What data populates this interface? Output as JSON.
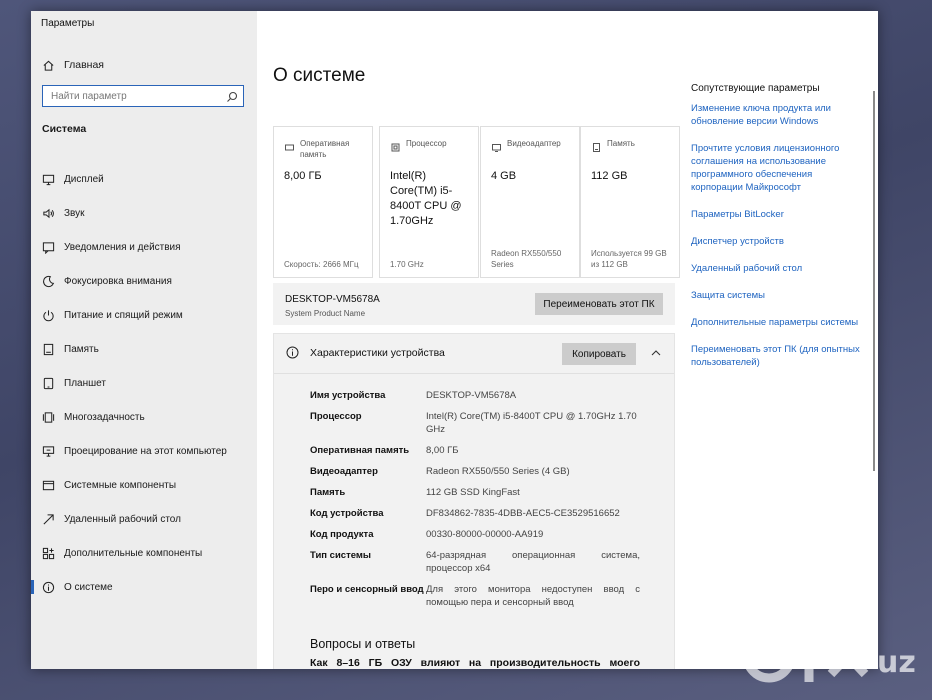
{
  "window": {
    "title": "Параметры"
  },
  "sidebar": {
    "home_label": "Главная",
    "search_placeholder": "Найти параметр",
    "section_title": "Система",
    "items": [
      {
        "label": "Дисплей",
        "icon": "monitor-icon"
      },
      {
        "label": "Звук",
        "icon": "speaker-icon"
      },
      {
        "label": "Уведомления и действия",
        "icon": "notification-icon"
      },
      {
        "label": "Фокусировка внимания",
        "icon": "moon-icon"
      },
      {
        "label": "Питание и спящий режим",
        "icon": "power-icon"
      },
      {
        "label": "Память",
        "icon": "storage-icon"
      },
      {
        "label": "Планшет",
        "icon": "tablet-icon"
      },
      {
        "label": "Многозадачность",
        "icon": "multitask-icon"
      },
      {
        "label": "Проецирование на этот компьютер",
        "icon": "projection-icon"
      },
      {
        "label": "Системные компоненты",
        "icon": "components-icon"
      },
      {
        "label": "Удаленный рабочий стол",
        "icon": "remote-icon"
      },
      {
        "label": "Дополнительные компоненты",
        "icon": "extras-icon"
      },
      {
        "label": "О системе",
        "icon": "info-icon",
        "active": true
      }
    ]
  },
  "main": {
    "title": "О системе",
    "cards": [
      {
        "label": "Оперативная память",
        "value": "8,00 ГБ",
        "sub": "Скорость: 2666 МГц",
        "icon": "ram-icon"
      },
      {
        "label": "Процессор",
        "value": "Intel(R) Core(TM) i5-8400T CPU @ 1.70GHz",
        "sub": "1.70 GHz",
        "icon": "cpu-icon"
      },
      {
        "label": "Видеоадаптер",
        "value": "4 GB",
        "sub": "Radeon RX550/550 Series",
        "icon": "gpu-icon"
      },
      {
        "label": "Память",
        "value": "112 GB",
        "sub": "Используется 99 GB из 112 GB",
        "icon": "storage-icon"
      }
    ],
    "device": {
      "name": "DESKTOP-VM5678A",
      "model": "System Product Name",
      "rename_label": "Переименовать этот ПК"
    },
    "specs": {
      "title": "Характеристики устройства",
      "copy_label": "Копировать",
      "rows": [
        {
          "key": "Имя устройства",
          "value": "DESKTOP-VM5678A"
        },
        {
          "key": "Процессор",
          "value": "Intel(R) Core(TM) i5-8400T CPU @ 1.70GHz   1.70 GHz"
        },
        {
          "key": "Оперативная память",
          "value": "8,00 ГБ"
        },
        {
          "key": "Видеоадаптер",
          "value": "Radeon RX550/550 Series (4 GB)"
        },
        {
          "key": "Память",
          "value": "112 GB SSD KingFast"
        },
        {
          "key": "Код устройства",
          "value": "DF834862-7835-4DBB-AEC5-CE3529516652"
        },
        {
          "key": "Код продукта",
          "value": "00330-80000-00000-AA919"
        },
        {
          "key": "Тип системы",
          "value": "64-разрядная операционная система, процессор x64"
        },
        {
          "key": "Перо и сенсорный ввод",
          "value": "Для этого монитора недоступен ввод с помощью пера и сенсорный ввод"
        }
      ]
    },
    "faq": {
      "title": "Вопросы и ответы",
      "question": "Как 8–16 ГБ ОЗУ влияют на производительность моего"
    }
  },
  "related": {
    "title": "Сопутствующие параметры",
    "links": [
      "Изменение ключа продукта или обновление версии Windows",
      "Прочтите условия лицензионного соглашения на использование программного обеспечения корпорации Майкрософт",
      "Параметры BitLocker",
      "Диспетчер устройств",
      "Удаленный рабочий стол",
      "Защита системы",
      "Дополнительные параметры системы",
      "Переименовать этот ПК (для опытных пользователей)"
    ]
  },
  "watermark": {
    "text": "olx.uz"
  },
  "colors": {
    "accent": "#1f64c0",
    "sidebar_bg": "#ededed",
    "button_bg": "#cccccc"
  }
}
